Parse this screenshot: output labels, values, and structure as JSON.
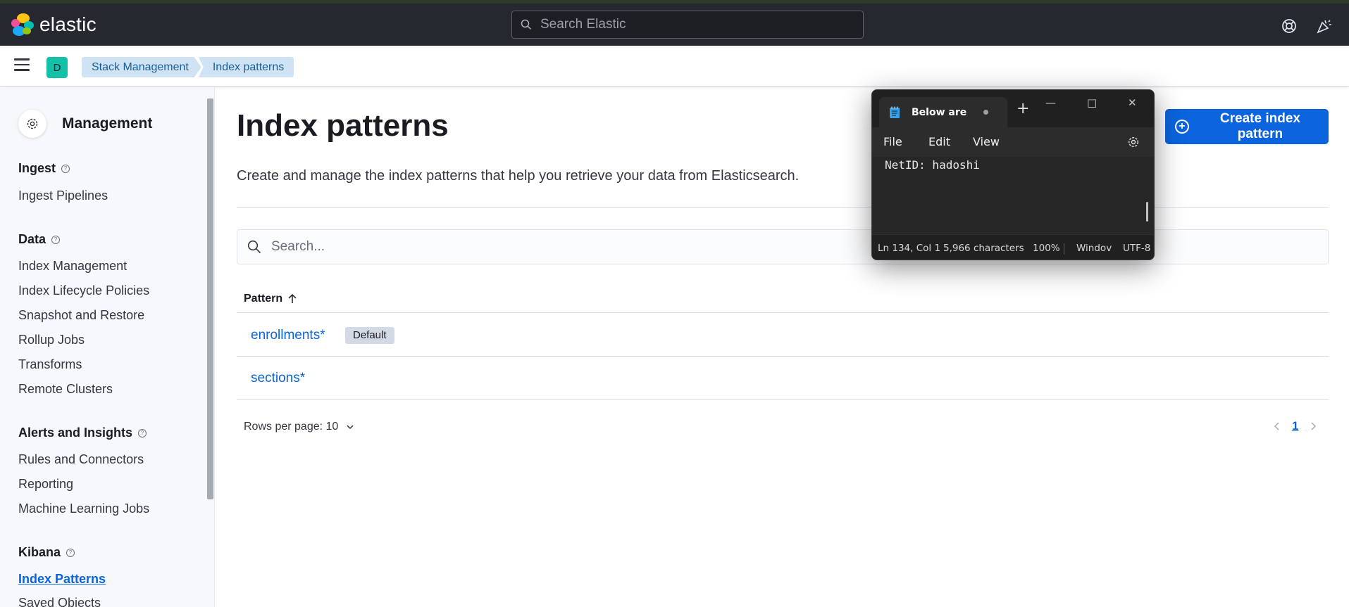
{
  "header": {
    "brand": "elastic",
    "search_placeholder": "Search Elastic"
  },
  "navbar": {
    "space_initial": "D",
    "breadcrumbs": [
      "Stack Management",
      "Index patterns"
    ]
  },
  "sidebar": {
    "title": "Management",
    "groups": [
      {
        "title": "Ingest",
        "items": [
          "Ingest Pipelines"
        ]
      },
      {
        "title": "Data",
        "items": [
          "Index Management",
          "Index Lifecycle Policies",
          "Snapshot and Restore",
          "Rollup Jobs",
          "Transforms",
          "Remote Clusters"
        ]
      },
      {
        "title": "Alerts and Insights",
        "items": [
          "Rules and Connectors",
          "Reporting",
          "Machine Learning Jobs"
        ]
      },
      {
        "title": "Kibana",
        "items": [
          "Index Patterns",
          "Saved Objects"
        ]
      }
    ],
    "active_item": "Index Patterns"
  },
  "main": {
    "title": "Index patterns",
    "description": "Create and manage the index patterns that help you retrieve your data from Elasticsearch.",
    "create_button": "Create index pattern",
    "search_placeholder": "Search...",
    "table": {
      "column": "Pattern",
      "rows": [
        {
          "name": "enrollments*",
          "badge": "Default"
        },
        {
          "name": "sections*",
          "badge": ""
        }
      ]
    },
    "rows_per_page": "Rows per page: 10",
    "current_page": "1"
  },
  "notepad": {
    "tab_title": "Below are",
    "menu": [
      "File",
      "Edit",
      "View"
    ],
    "content": "NetID: hadoshi",
    "status": {
      "position": "Ln 134, Col 1",
      "characters": "5,966 characters",
      "zoom": "100%",
      "line_ending": "Windov",
      "encoding": "UTF-8"
    }
  },
  "colors": {
    "header_bg": "#25282f",
    "accent": "#0b64dd",
    "breadcrumb_bg": "#cfe3f4",
    "space_avatar": "#14c0a8",
    "notepad_bg": "#202020"
  }
}
